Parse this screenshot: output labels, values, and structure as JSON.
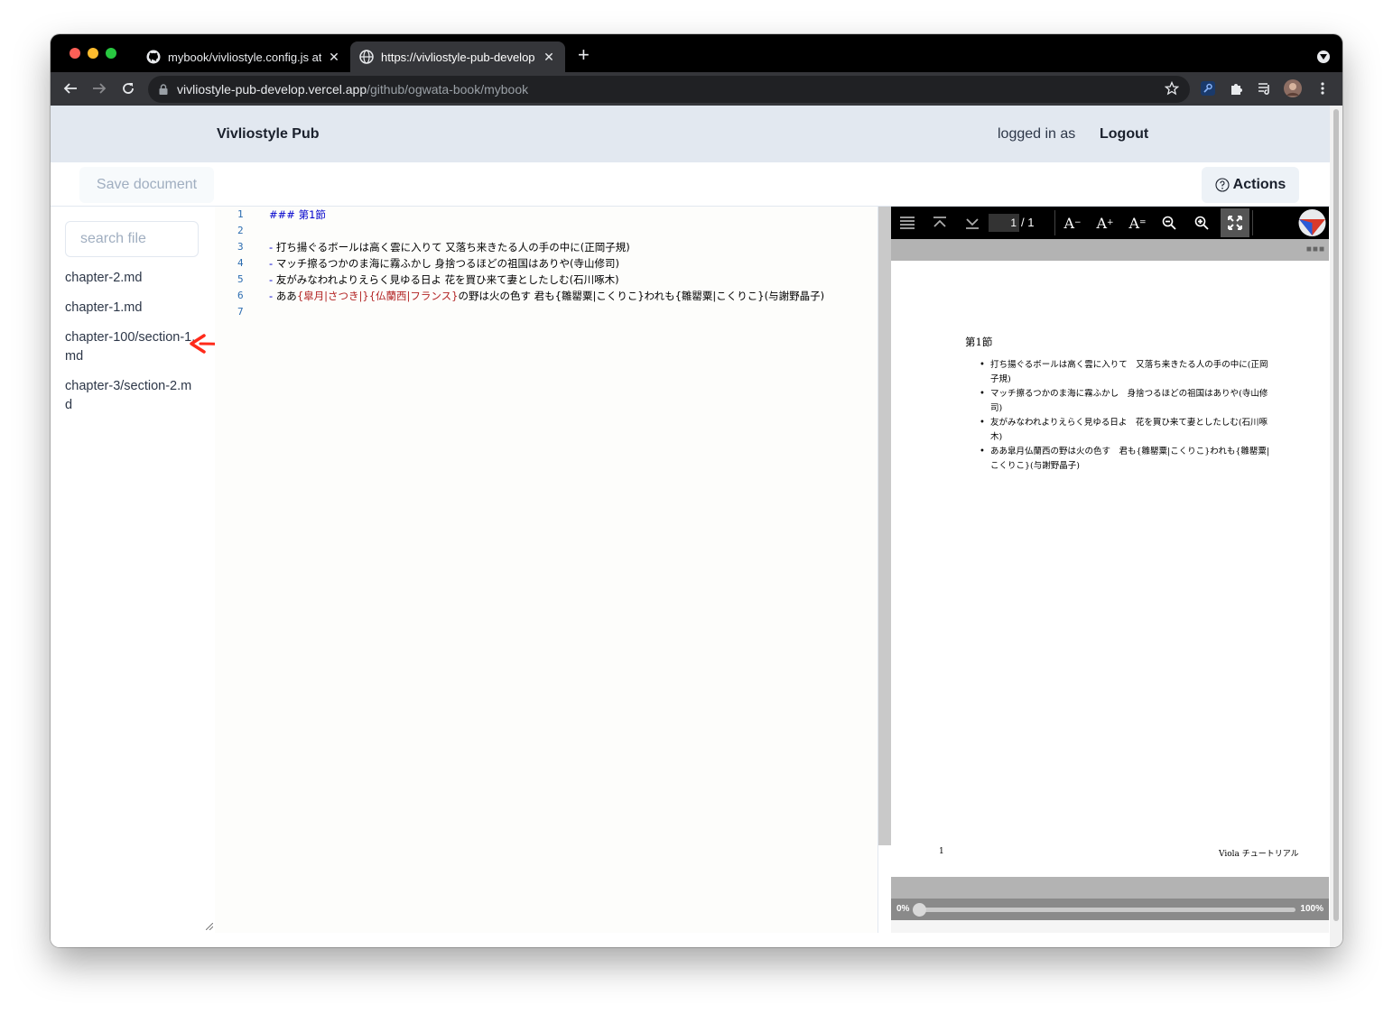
{
  "browser": {
    "tabs": [
      {
        "title": "mybook/vivliostyle.config.js at",
        "icon": "github-icon"
      },
      {
        "title": "https://vivliostyle-pub-develop",
        "icon": "globe-icon"
      }
    ],
    "url_host": "vivliostyle-pub-develop.vercel.app",
    "url_path": "/github/ogwata-book/mybook"
  },
  "header": {
    "brand": "Vivliostyle Pub",
    "logged_in_label": "logged in as",
    "logout_label": "Logout"
  },
  "actionbar": {
    "save_label": "Save document",
    "actions_label": "Actions"
  },
  "sidebar": {
    "search_placeholder": "search file",
    "files": [
      "chapter-2.md",
      "chapter-1.md",
      "chapter-100/section-1.md",
      "chapter-3/section-2.md"
    ]
  },
  "editor": {
    "lines": [
      {
        "num": "1",
        "heading": "### 第1節"
      },
      {
        "num": "2"
      },
      {
        "num": "3",
        "bullet": "-",
        "text": "打ち揚ぐるボールは高く雲に入りて 又落ち来きたる人の手の中に(正岡子規)"
      },
      {
        "num": "4",
        "bullet": "-",
        "text": "マッチ擦るつかのま海に霧ふかし 身捨つるほどの祖国はありや(寺山修司)"
      },
      {
        "num": "5",
        "bullet": "-",
        "text": "友がみなわれよりえらく見ゆる日よ 花を買ひ来て妻としたしむ(石川啄木)"
      },
      {
        "num": "6",
        "bullet": "-",
        "pre": "ああ",
        "ruby": "{皐月|さつき|}{仏蘭西|フランス}",
        "post": "の野は火の色す 君も{雛罌粟|こくりこ}われも{雛罌粟|こくりこ}(与謝野晶子)"
      },
      {
        "num": "7"
      }
    ]
  },
  "viewer": {
    "page_current": "1",
    "page_total": "/ 1",
    "heading": "第1節",
    "items": [
      "打ち揚ぐるボールは高く雲に入りて　又落ち来きたる人の手の中に(正岡子規)",
      "マッチ擦るつかのま海に霧ふかし　身捨つるほどの祖国はありや(寺山修司)",
      "友がみなわれよりえらく見ゆる日よ　花を買ひ来て妻としたしむ(石川啄木)",
      "ああ皐月仏蘭西の野は火の色す　君も{雛罌粟|こくりこ}われも{雛罌粟|こくりこ}(与謝野晶子)"
    ],
    "footer_page": "1",
    "footer_title": "Viola チュートリアル",
    "slider_min": "0%",
    "slider_max": "100%",
    "slider_value": 0
  }
}
